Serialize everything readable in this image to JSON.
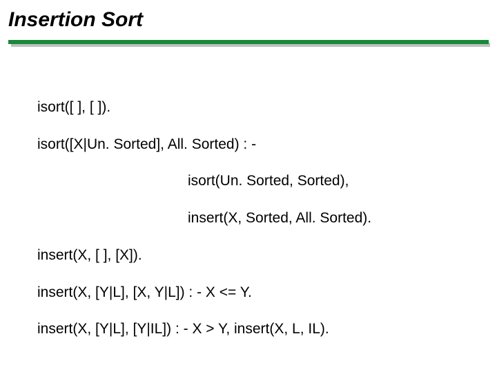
{
  "slide": {
    "title": "Insertion Sort",
    "code": {
      "line1": "isort([ ], [ ]).",
      "line2": "isort([X|Un. Sorted], All. Sorted) : -",
      "line3": "isort(Un. Sorted, Sorted),",
      "line4": "insert(X, Sorted, All. Sorted).",
      "line5": "insert(X, [ ], [X]).",
      "line6": "insert(X, [Y|L], [X, Y|L]) : - X <= Y.",
      "line7": "insert(X, [Y|L], [Y|IL]) : - X > Y, insert(X, L, IL)."
    }
  }
}
